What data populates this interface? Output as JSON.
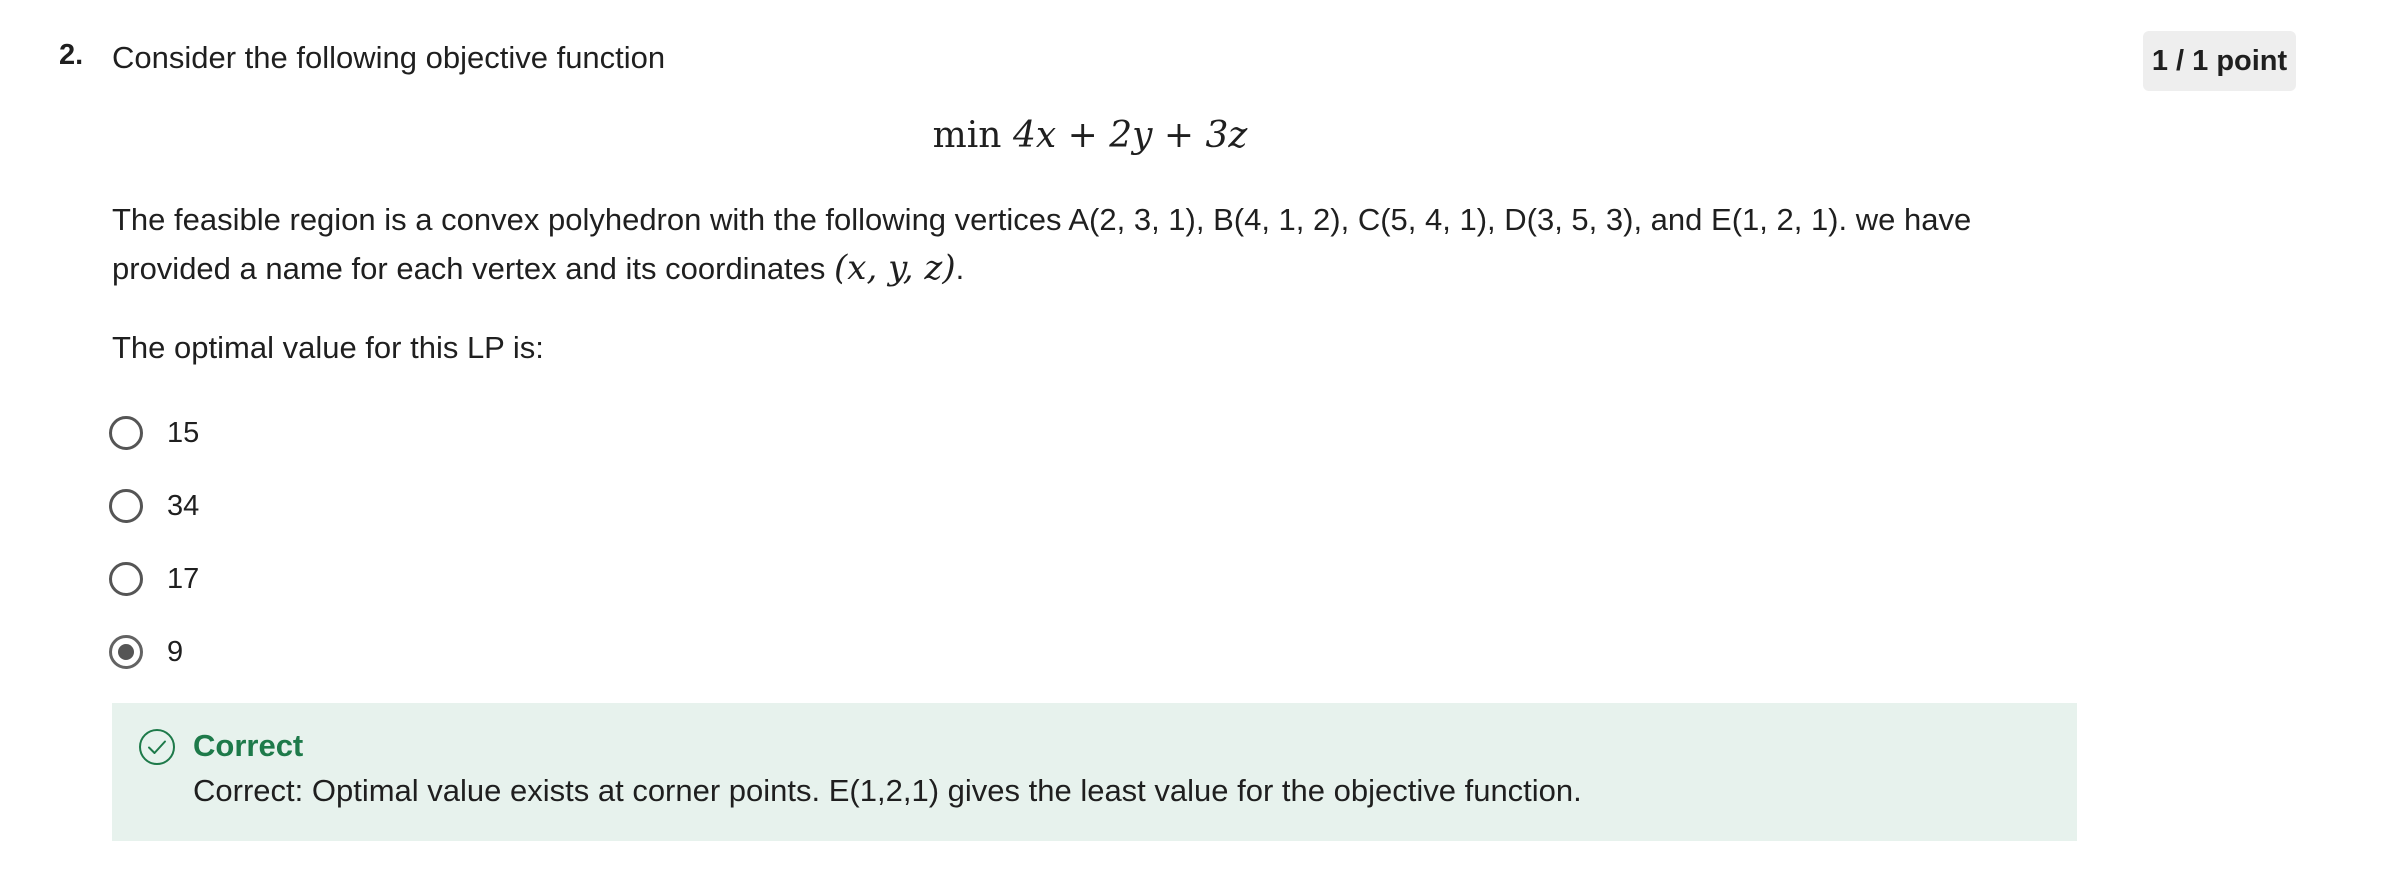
{
  "question": {
    "number": "2.",
    "prompt": "Consider the following objective function",
    "points": "1 / 1 point",
    "objective": {
      "operator": "min",
      "expression": "4x + 2y + 3z"
    },
    "description": "The feasible region is a  convex polyhedron with the following vertices A(2, 3, 1), B(4, 1, 2), C(5, 4, 1), D(3, 5, 3), and E(1, 2, 1).  we have provided a name for each vertex and its coordinates",
    "coordinates_notation": "(x, y, z)",
    "description_end": ".",
    "optimal_prompt": "The optimal value for this LP is:"
  },
  "options": [
    {
      "label": "15",
      "selected": false
    },
    {
      "label": "34",
      "selected": false
    },
    {
      "label": "17",
      "selected": false
    },
    {
      "label": "9",
      "selected": true
    }
  ],
  "feedback": {
    "icon": "check-circle-icon",
    "status": "Correct",
    "message": "Correct: Optimal value exists at corner points. E(1,2,1) gives the least value for the objective function.",
    "accent_color": "#1e7a4a",
    "background_color": "#e7f2ed"
  }
}
